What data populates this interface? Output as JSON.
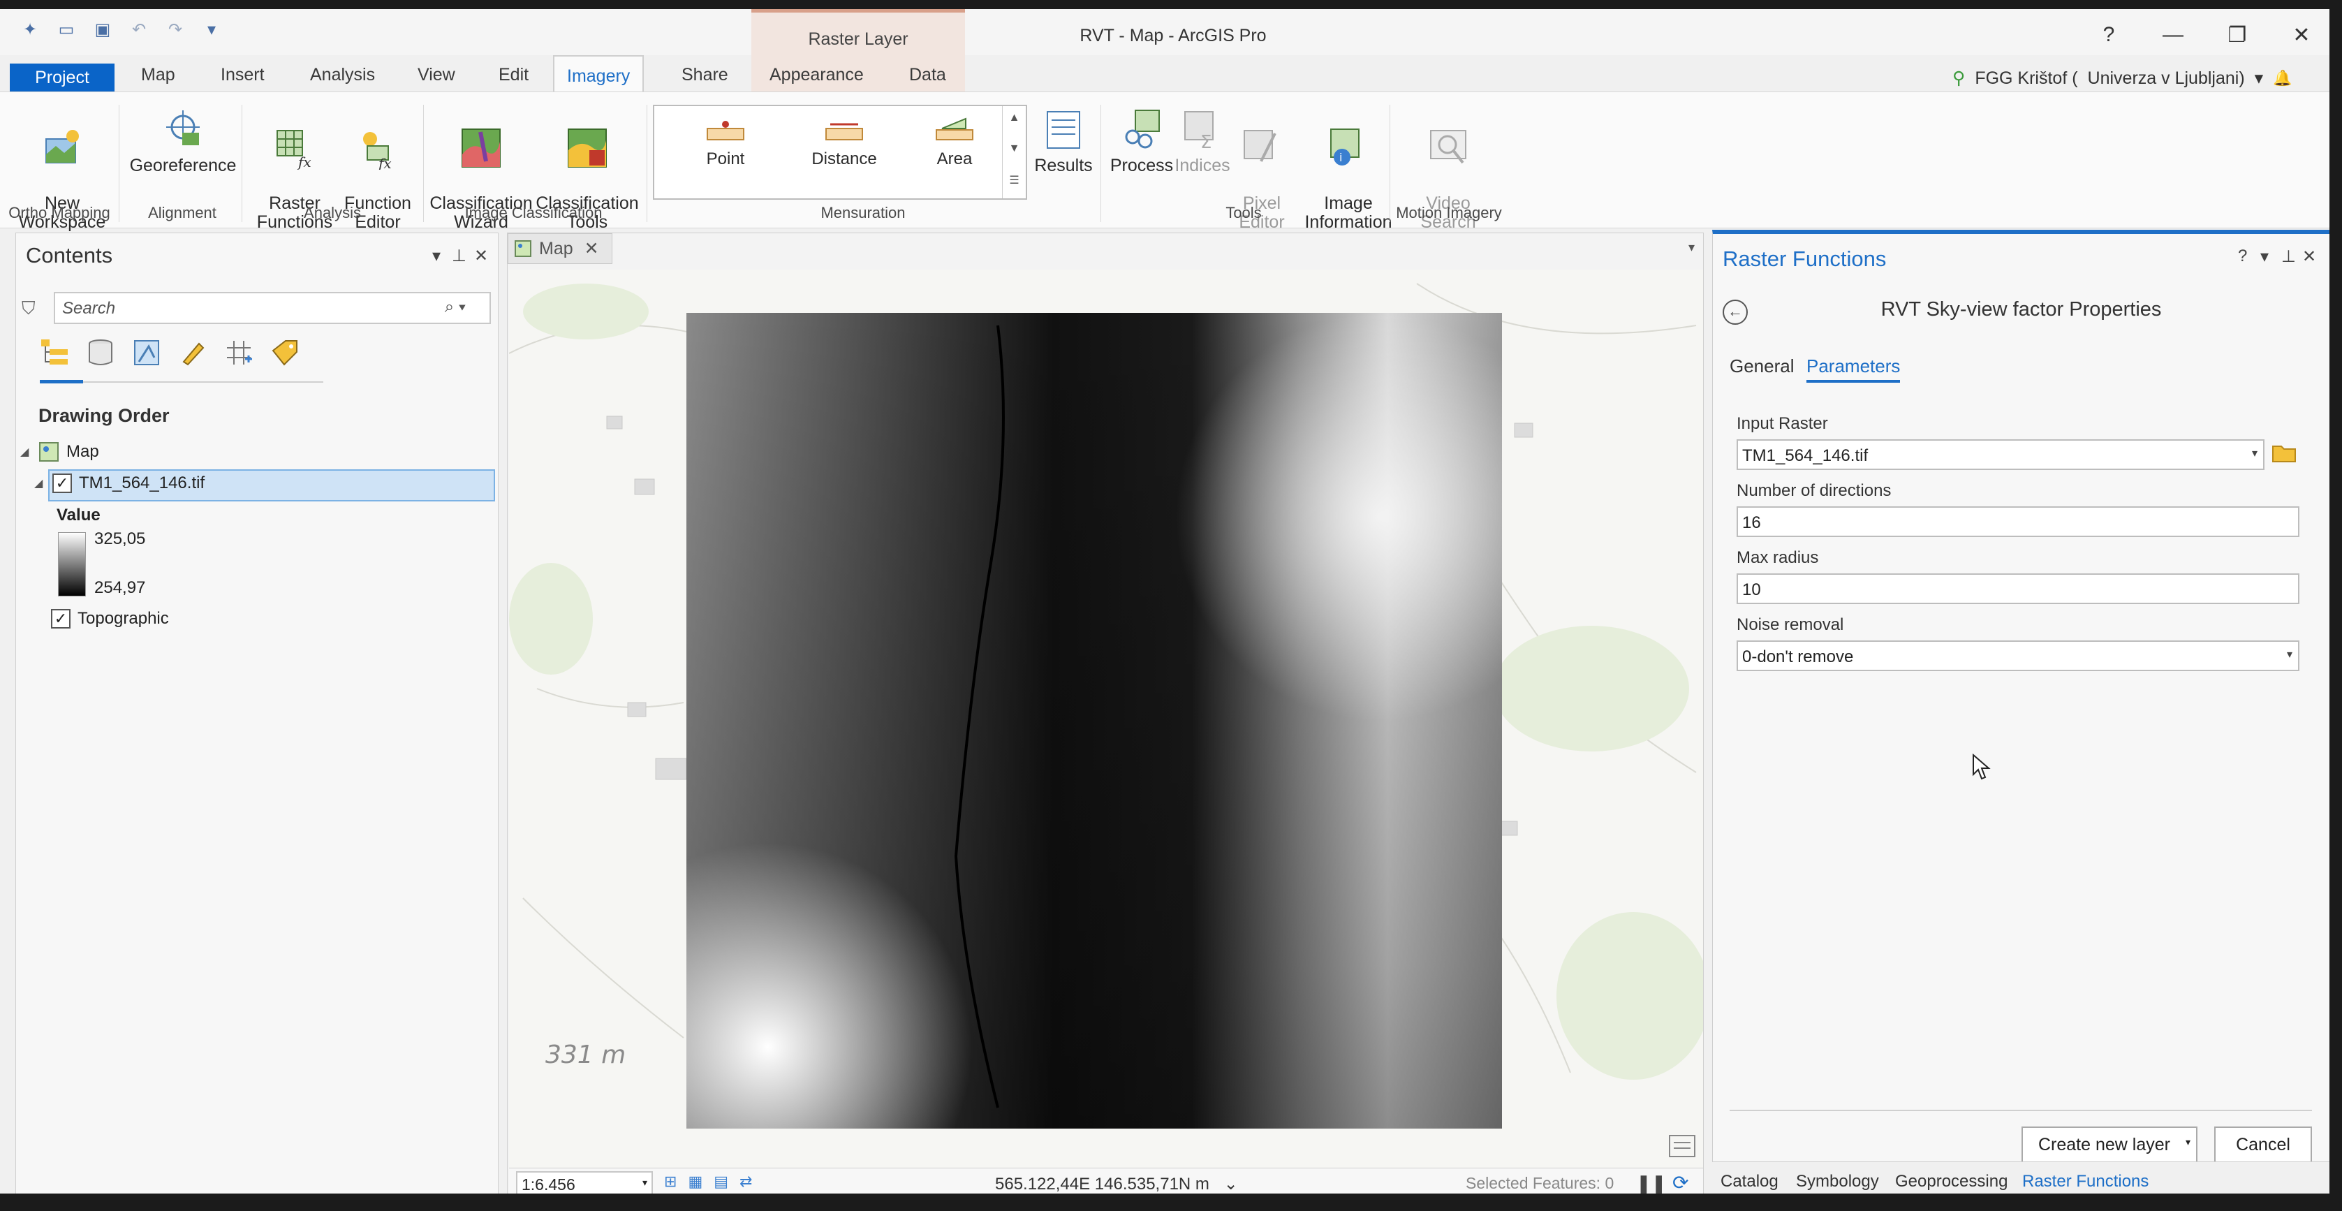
{
  "window": {
    "title": "RVT - Map - ArcGIS Pro",
    "context_group": "Raster Layer",
    "help": "?",
    "minimize": "—",
    "restore": "❐",
    "close": "✕"
  },
  "ribbon_tabs": [
    "Project",
    "Map",
    "Insert",
    "Analysis",
    "View",
    "Edit",
    "Imagery",
    "Share",
    "Appearance",
    "Data"
  ],
  "active_tab": "Imagery",
  "user": {
    "name": "FGG Krištof (",
    "org": "Univerza v Ljubljani)",
    "chevron": "▾",
    "bell": "🔔"
  },
  "ribbon": {
    "new_workspace": "New\nWorkspace",
    "georeference": "Georeference",
    "raster_functions": "Raster\nFunctions",
    "function_editor": "Function\nEditor",
    "classification_wizard": "Classification\nWizard",
    "classification_tools": "Classification\nTools",
    "point": "Point",
    "distance": "Distance",
    "area": "Area",
    "results": "Results",
    "process": "Process",
    "indices": "Indices",
    "pixel_editor": "Pixel\nEditor",
    "image_information": "Image\nInformation",
    "video_search": "Video\nSearch",
    "groups": {
      "ortho_mapping": "Ortho Mapping",
      "alignment": "Alignment",
      "analysis": "Analysis",
      "image_classification": "Image Classification",
      "mensuration": "Mensuration",
      "tools": "Tools",
      "motion_imagery": "Motion Imagery"
    }
  },
  "contents": {
    "title": "Contents",
    "search_placeholder": "Search",
    "drawing_order": "Drawing Order",
    "map_label": "Map",
    "layer_name": "TM1_564_146.tif",
    "legend_title": "Value",
    "legend_max": "325,05",
    "legend_min": "254,97",
    "basemap": "Topographic"
  },
  "map": {
    "tab_label": "Map",
    "contour_label": "331 m",
    "scale": "1:6.456",
    "coordinates": "565.122,44E 146.535,71N m",
    "selected_features": "Selected Features: 0"
  },
  "raster_functions": {
    "pane_title": "Raster Functions",
    "heading": "RVT Sky-view factor Properties",
    "tabs": [
      "General",
      "Parameters"
    ],
    "active_tab": "Parameters",
    "input_raster_label": "Input Raster",
    "input_raster_value": "TM1_564_146.tif",
    "directions_label": "Number of directions",
    "directions_value": "16",
    "max_radius_label": "Max radius",
    "max_radius_value": "10",
    "noise_label": "Noise removal",
    "noise_value": "0-don't remove",
    "create_button": "Create new layer",
    "cancel_button": "Cancel"
  },
  "bottom_tabs": [
    "Catalog",
    "Symbology",
    "Geoprocessing",
    "Raster Functions"
  ],
  "colors": {
    "accent": "#1e6fc7",
    "project_tab": "#0a64c8",
    "context_tab_bg": "#f2e5df"
  }
}
